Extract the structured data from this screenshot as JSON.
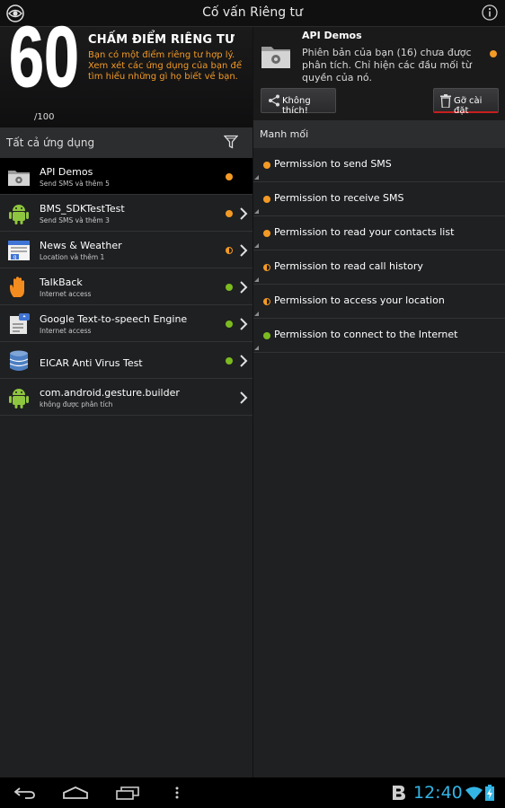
{
  "app": {
    "title": "Cố vấn Riêng tư"
  },
  "score": {
    "value": "60",
    "max": "/100",
    "heading": "CHẤM ĐIỂM RIÊNG TƯ",
    "description": "Bạn có một điểm riêng tư hợp lý. Xem xét các ứng dụng của bạn để tìm hiểu những gì họ biết về bạn."
  },
  "selected_app": {
    "name": "API Demos",
    "description": "Phiên bản của bạn (16) chưa được phân tích. Chỉ hiện các đầu mối từ quyền của nó.",
    "dislike_label": "Không thích!",
    "uninstall_label": "Gỡ cài đặt"
  },
  "apps_header": {
    "label": "Tất cả ứng dụng"
  },
  "apps": [
    {
      "name": "API Demos",
      "sub": "Send SMS và thêm 5",
      "icon": "api-demos-icon",
      "status": "orange"
    },
    {
      "name": "BMS_SDKTestTest",
      "sub": "Send SMS và thêm 3",
      "icon": "android-icon",
      "status": "orange"
    },
    {
      "name": "News & Weather",
      "sub": "Location và thêm 1",
      "icon": "news-weather-icon",
      "status": "half"
    },
    {
      "name": "TalkBack",
      "sub": "Internet access",
      "icon": "hand-icon",
      "status": "green"
    },
    {
      "name": "Google Text-to-speech Engine",
      "sub": "Internet access",
      "icon": "tts-icon",
      "status": "green"
    },
    {
      "name": "EICAR Anti Virus Test",
      "sub": "",
      "icon": "database-icon",
      "status": "green"
    },
    {
      "name": "com.android.gesture.builder",
      "sub": "không được phân tích",
      "icon": "android-icon",
      "status": "none"
    }
  ],
  "clues_header": {
    "label": "Manh mối"
  },
  "clues": [
    {
      "text": "Permission to send SMS",
      "status": "orange"
    },
    {
      "text": "Permission to receive SMS",
      "status": "orange"
    },
    {
      "text": "Permission to read your contacts list",
      "status": "orange"
    },
    {
      "text": "Permission to read call history",
      "status": "half"
    },
    {
      "text": "Permission to access your location",
      "status": "half"
    },
    {
      "text": "Permission to connect to the Internet",
      "status": "green"
    }
  ],
  "status_bar": {
    "time": "12:40"
  },
  "colors": {
    "accent_orange": "#f39a25",
    "accent_green": "#7cbb1f",
    "clock_blue": "#33b5e5",
    "uninstall_red": "#c81e1e"
  }
}
